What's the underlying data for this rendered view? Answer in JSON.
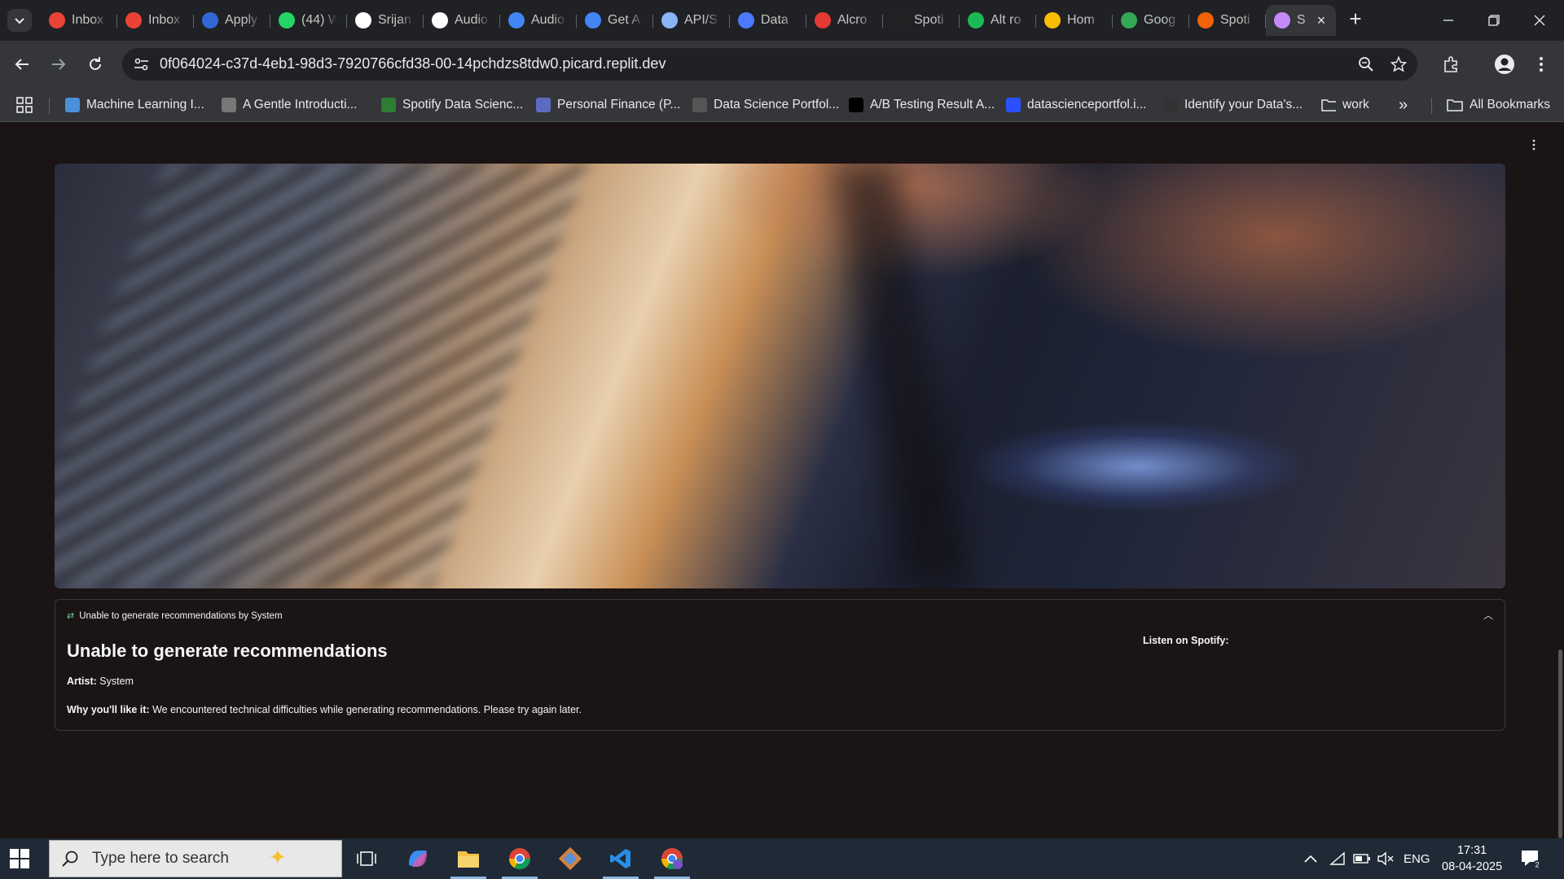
{
  "browser": {
    "tabs": [
      {
        "title": "Inbox",
        "favicon": "gmail-icon",
        "color": "#ea4335"
      },
      {
        "title": "Inbox",
        "favicon": "gmail-icon",
        "color": "#ea4335"
      },
      {
        "title": "Apply",
        "favicon": "apply-icon",
        "color": "#3367d6"
      },
      {
        "title": "(44) W",
        "favicon": "whatsapp-icon",
        "color": "#25d366"
      },
      {
        "title": "Srijan",
        "favicon": "github-icon",
        "color": "#ffffff"
      },
      {
        "title": "Audio",
        "favicon": "openai-icon",
        "color": "#ffffff"
      },
      {
        "title": "Audio",
        "favicon": "butterfly-icon",
        "color": "#4285f4"
      },
      {
        "title": "Get A",
        "favicon": "butterfly-icon",
        "color": "#4285f4"
      },
      {
        "title": "API/S",
        "favicon": "api-icon",
        "color": "#8ab4f8"
      },
      {
        "title": "Data",
        "favicon": "spotify-developer-icon",
        "color": "#4d79ff"
      },
      {
        "title": "Alcro",
        "favicon": "alcro-icon",
        "color": "#e53935"
      },
      {
        "title": "Spoti",
        "favicon": "spotify-dark-icon",
        "color": "#222222"
      },
      {
        "title": "Alt ro",
        "favicon": "spotify-icon",
        "color": "#1db954"
      },
      {
        "title": "Hom",
        "favicon": "google-drive-icon",
        "color": "#fbbc04"
      },
      {
        "title": "Goog",
        "favicon": "google-maps-icon",
        "color": "#34a853"
      },
      {
        "title": "Spoti",
        "favicon": "replit-icon",
        "color": "#f26207"
      },
      {
        "title": "S",
        "favicon": "music-note-icon",
        "color": "#c58af9",
        "active": true
      }
    ],
    "url": "0f064024-c37d-4eb1-98d3-7920766cfd38-00-14pchdzs8tdw0.picard.replit.dev",
    "bookmarks": [
      {
        "label": "Machine Learning I...",
        "icon": "mountain-icon",
        "color": "#4a90d9"
      },
      {
        "label": "A Gentle Introducti...",
        "icon": "gentle-icon",
        "color": "#777777"
      },
      {
        "label": "Spotify Data Scienc...",
        "icon": "link-icon",
        "color": "#2e7d32"
      },
      {
        "label": "Personal Finance (P...",
        "icon": "shield-icon",
        "color": "#5c6bc0"
      },
      {
        "label": "Data Science Portfol...",
        "icon": "portfolio-icon",
        "color": "#555555"
      },
      {
        "label": "A/B Testing Result A...",
        "icon": "medium-icon",
        "color": "#000000"
      },
      {
        "label": "datascienceportfol.i...",
        "icon": "d-icon",
        "color": "#2b50ff"
      },
      {
        "label": "Identify your Data's...",
        "icon": "tds-icon",
        "color": "#333333"
      },
      {
        "label": "work",
        "icon": "folder-icon",
        "color": "#e8eaed"
      }
    ],
    "all_bookmarks_label": "All Bookmarks"
  },
  "app": {
    "card": {
      "header": "Unable to generate recommendations by System",
      "title": "Unable to generate recommendations",
      "artist_label": "Artist:",
      "artist_value": "System",
      "why_label": "Why you'll like it:",
      "why_value": "We encountered technical difficulties while generating recommendations. Please try again later.",
      "listen_label": "Listen on Spotify:"
    }
  },
  "taskbar": {
    "search_placeholder": "Type here to search",
    "language": "ENG",
    "time": "17:31",
    "date": "08-04-2025"
  }
}
